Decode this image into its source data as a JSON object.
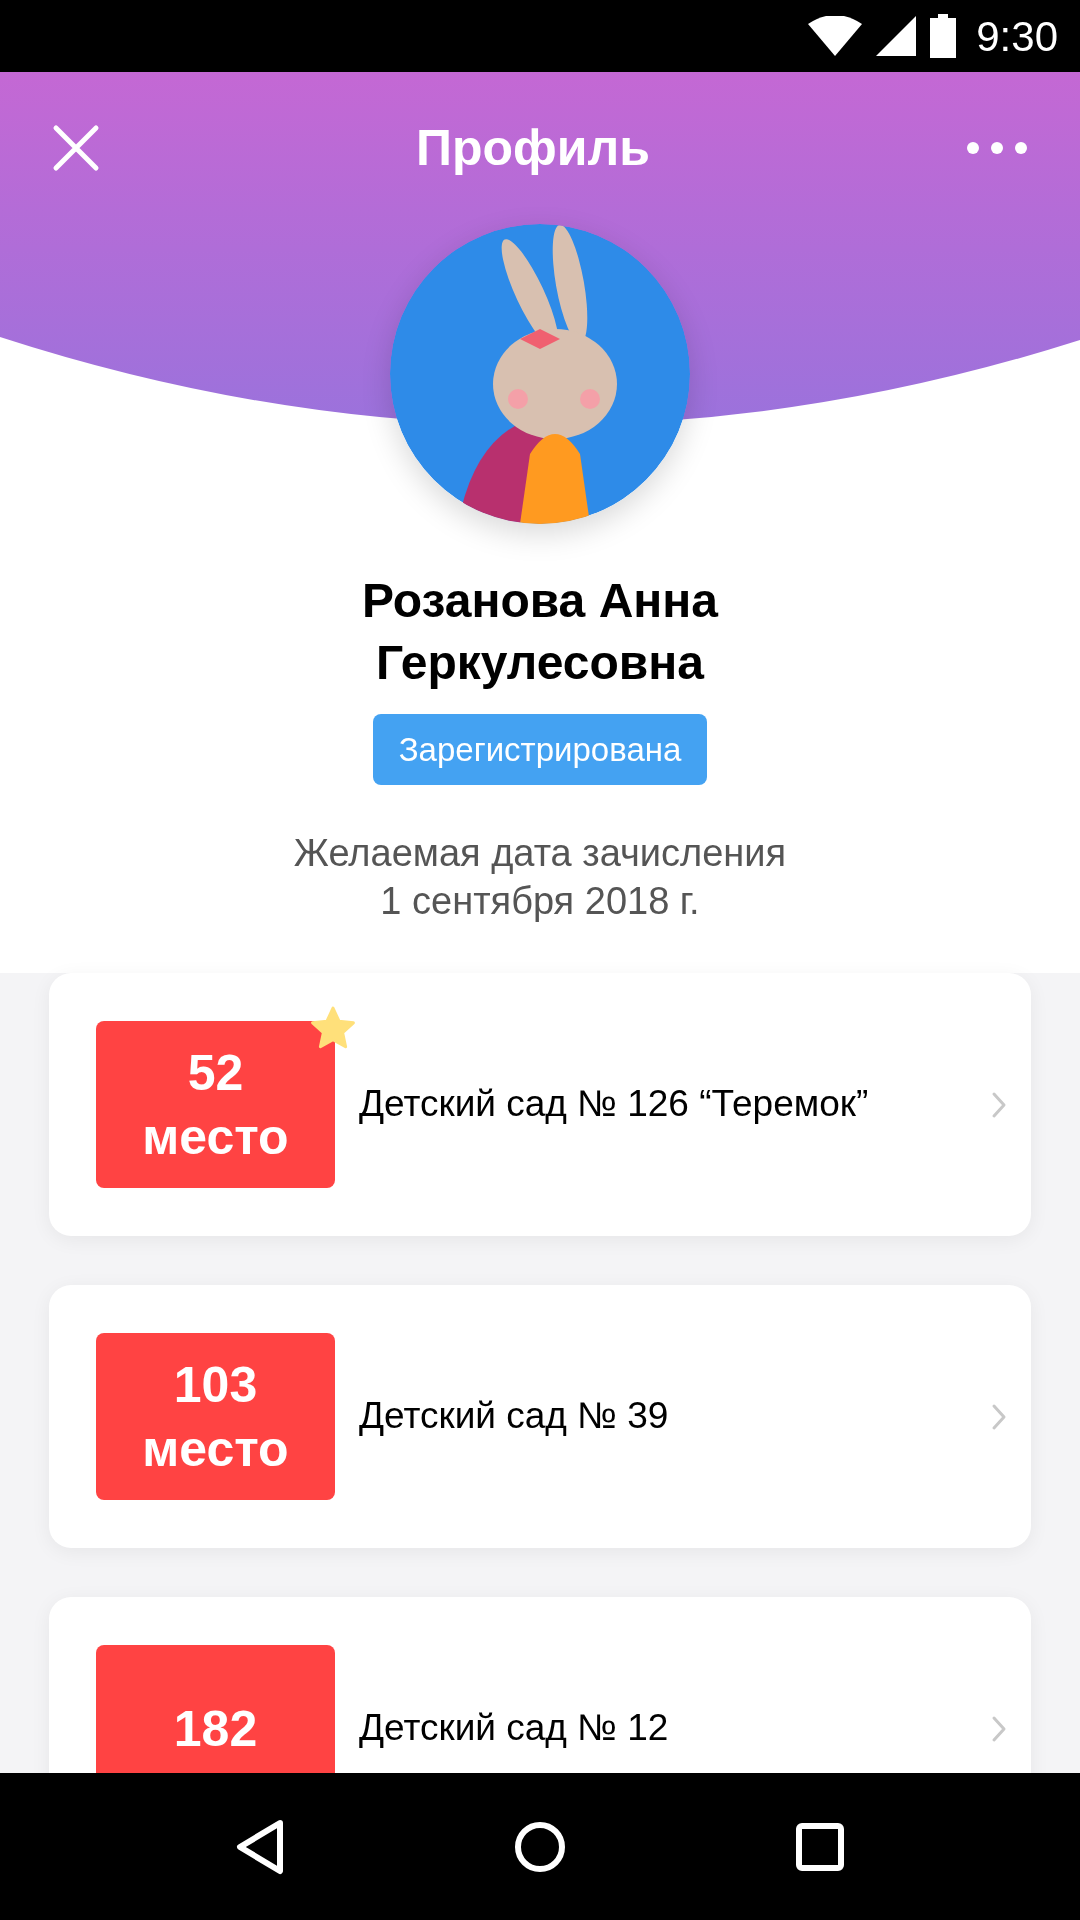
{
  "status_bar": {
    "time": "9:30"
  },
  "header": {
    "title": "Профиль"
  },
  "profile": {
    "name": "Розанова Анна Геркулесовна",
    "status": "Зарегистрирована",
    "date_label": "Желаемая дата зачисления",
    "date": "1 сентября 2018 г."
  },
  "applications": [
    {
      "place": "52",
      "place_label": "место",
      "name": "Детский сад № 126 “Теремок”",
      "favorite": true
    },
    {
      "place": "103",
      "place_label": "место",
      "name": "Детский сад № 39",
      "favorite": false
    },
    {
      "place": "182",
      "name": "Детский сад № 12",
      "favorite": false
    }
  ]
}
